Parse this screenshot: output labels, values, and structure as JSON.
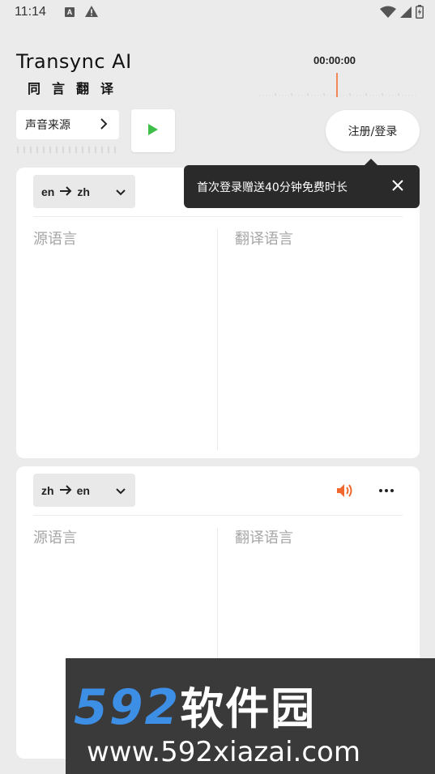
{
  "status_bar": {
    "time": "11:14",
    "notif_icon_letter": "A",
    "icons": [
      "a-notification-icon",
      "warning-icon",
      "wifi-icon",
      "signal-icon",
      "battery-charging-icon"
    ]
  },
  "header": {
    "logo_en": "Transync AI",
    "logo_zh": "同言翻译",
    "timer": "00:00:00",
    "source_button_label": "声音来源",
    "login_label": "注册/登录"
  },
  "tooltip": {
    "text": "首次登录赠送40分钟免费时长"
  },
  "panels": [
    {
      "from_lang": "en",
      "to_lang": "zh",
      "source_placeholder": "源语言",
      "target_placeholder": "翻译语言"
    },
    {
      "from_lang": "zh",
      "to_lang": "en",
      "source_placeholder": "源语言",
      "target_placeholder": "翻译语言"
    }
  ],
  "watermark": {
    "brand_num": "592",
    "brand_zh": "软件园",
    "url": "www.592xiazai.com"
  },
  "colors": {
    "accent_orange": "#f0682d",
    "play_green": "#3dbf4a",
    "watermark_blue": "#3d8fe6"
  }
}
